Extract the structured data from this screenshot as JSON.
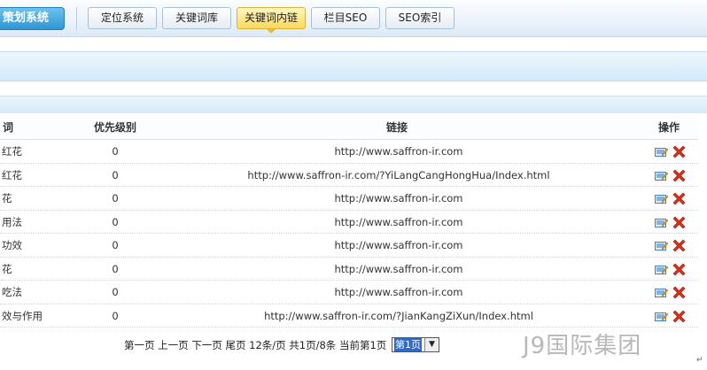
{
  "nav": {
    "brand": "策划系统",
    "tabs": [
      {
        "label": "定位系统",
        "active": false
      },
      {
        "label": "关键词库",
        "active": false
      },
      {
        "label": "关键词内链",
        "active": true
      },
      {
        "label": "栏目SEO",
        "active": false
      },
      {
        "label": "SEO索引",
        "active": false
      }
    ]
  },
  "table": {
    "headers": {
      "word": "词",
      "priority": "优先级别",
      "link": "链接",
      "ops": "操作"
    },
    "rows": [
      {
        "word": "红花",
        "priority": "0",
        "link": "http://www.saffron-ir.com"
      },
      {
        "word": "红花",
        "priority": "0",
        "link": "http://www.saffron-ir.com/?YiLangCangHongHua/Index.html"
      },
      {
        "word": "花",
        "priority": "0",
        "link": "http://www.saffron-ir.com"
      },
      {
        "word": "用法",
        "priority": "0",
        "link": "http://www.saffron-ir.com"
      },
      {
        "word": "功效",
        "priority": "0",
        "link": "http://www.saffron-ir.com"
      },
      {
        "word": "花",
        "priority": "0",
        "link": "http://www.saffron-ir.com"
      },
      {
        "word": "吃法",
        "priority": "0",
        "link": "http://www.saffron-ir.com"
      },
      {
        "word": "效与作用",
        "priority": "0",
        "link": "http://www.saffron-ir.com/?JianKangZiXun/Index.html"
      }
    ],
    "icons": {
      "edit": "edit-icon",
      "delete": "delete-icon"
    }
  },
  "pager": {
    "first": "第一页",
    "prev": "上一页",
    "next": "下一页",
    "last": "尾页",
    "per_page": "12条/页",
    "total": "共1页/8条",
    "current": "当前第1页",
    "select_value": "第1页"
  },
  "watermark": "J9国际集团",
  "colors": {
    "accent": "#2f95d4",
    "active_tab": "#fbd95a",
    "delete": "#d9311b"
  }
}
